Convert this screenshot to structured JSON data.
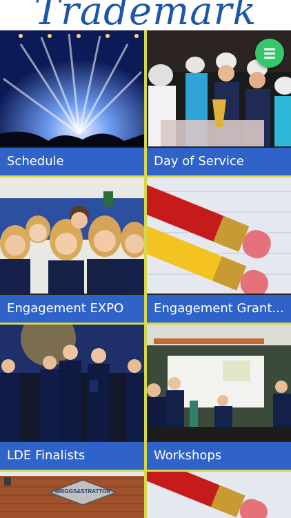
{
  "header": {
    "logo_text": "Trademark"
  },
  "menu_button": {
    "icon": "hamburger-menu-icon",
    "color": "#35c86a"
  },
  "tiles": [
    {
      "label": "Schedule"
    },
    {
      "label": "Day of Service"
    },
    {
      "label": "Engagement EXPO"
    },
    {
      "label": "Engagement Grant..."
    },
    {
      "label": "LDE Finalists"
    },
    {
      "label": "Workshops"
    }
  ],
  "partial_tiles": {
    "briggs_sign": "BRIGGS&STRATTON"
  },
  "colors": {
    "brand_blue": "#1f55a8",
    "tile_label_bg": "#2f63c9",
    "grid_gap": "#d6d84c"
  }
}
